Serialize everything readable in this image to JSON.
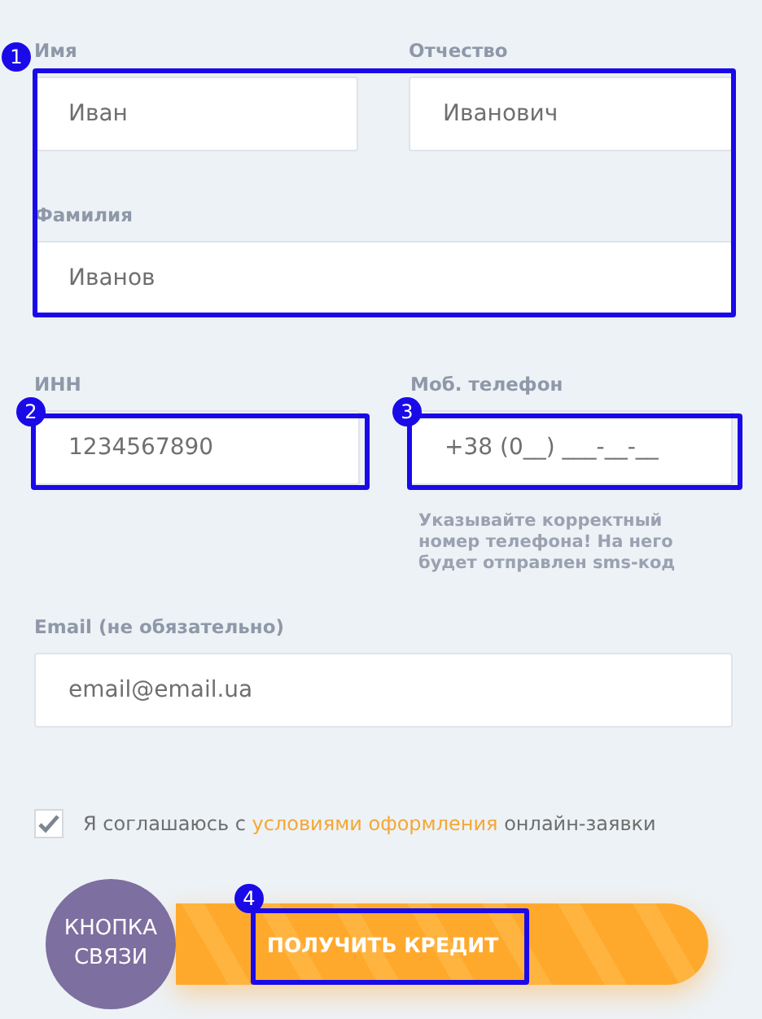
{
  "name_section": {
    "marker": "1",
    "rows": [
      [
        {
          "label": "Имя",
          "value": "Иван"
        },
        {
          "label": "Отчество",
          "value": "Иванович"
        }
      ],
      [
        {
          "label": "Фамилия",
          "value": "Иванов"
        }
      ]
    ]
  },
  "inn": {
    "label": "ИНН",
    "value": "1234567890",
    "marker": "2"
  },
  "phone": {
    "label": "Моб. телефон",
    "value": "+38 (0__) ___-__-__",
    "marker": "3",
    "hint": "Указывайте корректный номер телефона! На него будет отправлен sms-код"
  },
  "email": {
    "label": "Email (не обязательно)",
    "value": "email@email.ua"
  },
  "consent": {
    "checked": true,
    "text_before": "Я соглашаюсь с",
    "link": "условиями оформления",
    "text_after": "онлайн-заявки"
  },
  "contact_button": {
    "label": "КНОПКА СВЯЗИ"
  },
  "submit": {
    "label": "ПОЛУЧИТЬ КРЕДИТ",
    "marker": "4"
  }
}
